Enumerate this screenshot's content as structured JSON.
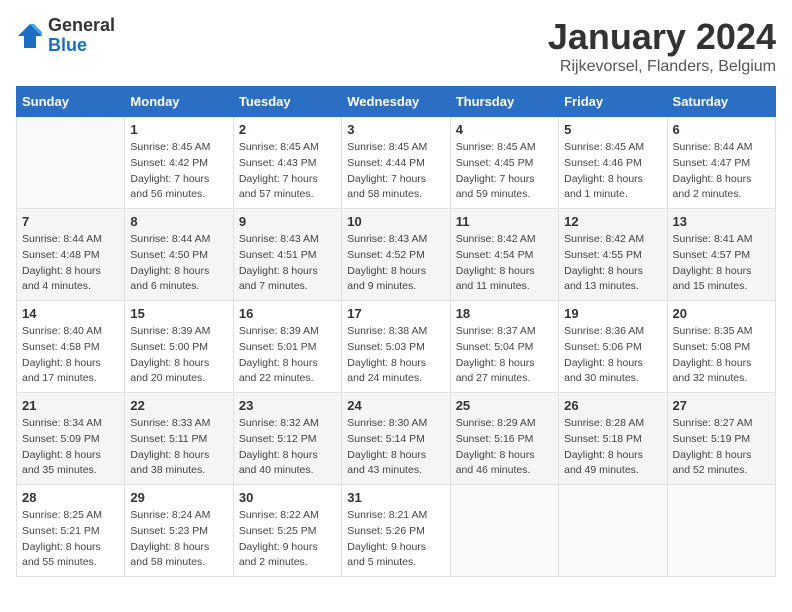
{
  "header": {
    "logo_line1": "General",
    "logo_line2": "Blue",
    "month_title": "January 2024",
    "location": "Rijkevorsel, Flanders, Belgium"
  },
  "weekdays": [
    "Sunday",
    "Monday",
    "Tuesday",
    "Wednesday",
    "Thursday",
    "Friday",
    "Saturday"
  ],
  "weeks": [
    [
      {
        "day": "",
        "info": ""
      },
      {
        "day": "1",
        "info": "Sunrise: 8:45 AM\nSunset: 4:42 PM\nDaylight: 7 hours\nand 56 minutes."
      },
      {
        "day": "2",
        "info": "Sunrise: 8:45 AM\nSunset: 4:43 PM\nDaylight: 7 hours\nand 57 minutes."
      },
      {
        "day": "3",
        "info": "Sunrise: 8:45 AM\nSunset: 4:44 PM\nDaylight: 7 hours\nand 58 minutes."
      },
      {
        "day": "4",
        "info": "Sunrise: 8:45 AM\nSunset: 4:45 PM\nDaylight: 7 hours\nand 59 minutes."
      },
      {
        "day": "5",
        "info": "Sunrise: 8:45 AM\nSunset: 4:46 PM\nDaylight: 8 hours\nand 1 minute."
      },
      {
        "day": "6",
        "info": "Sunrise: 8:44 AM\nSunset: 4:47 PM\nDaylight: 8 hours\nand 2 minutes."
      }
    ],
    [
      {
        "day": "7",
        "info": "Sunrise: 8:44 AM\nSunset: 4:48 PM\nDaylight: 8 hours\nand 4 minutes."
      },
      {
        "day": "8",
        "info": "Sunrise: 8:44 AM\nSunset: 4:50 PM\nDaylight: 8 hours\nand 6 minutes."
      },
      {
        "day": "9",
        "info": "Sunrise: 8:43 AM\nSunset: 4:51 PM\nDaylight: 8 hours\nand 7 minutes."
      },
      {
        "day": "10",
        "info": "Sunrise: 8:43 AM\nSunset: 4:52 PM\nDaylight: 8 hours\nand 9 minutes."
      },
      {
        "day": "11",
        "info": "Sunrise: 8:42 AM\nSunset: 4:54 PM\nDaylight: 8 hours\nand 11 minutes."
      },
      {
        "day": "12",
        "info": "Sunrise: 8:42 AM\nSunset: 4:55 PM\nDaylight: 8 hours\nand 13 minutes."
      },
      {
        "day": "13",
        "info": "Sunrise: 8:41 AM\nSunset: 4:57 PM\nDaylight: 8 hours\nand 15 minutes."
      }
    ],
    [
      {
        "day": "14",
        "info": "Sunrise: 8:40 AM\nSunset: 4:58 PM\nDaylight: 8 hours\nand 17 minutes."
      },
      {
        "day": "15",
        "info": "Sunrise: 8:39 AM\nSunset: 5:00 PM\nDaylight: 8 hours\nand 20 minutes."
      },
      {
        "day": "16",
        "info": "Sunrise: 8:39 AM\nSunset: 5:01 PM\nDaylight: 8 hours\nand 22 minutes."
      },
      {
        "day": "17",
        "info": "Sunrise: 8:38 AM\nSunset: 5:03 PM\nDaylight: 8 hours\nand 24 minutes."
      },
      {
        "day": "18",
        "info": "Sunrise: 8:37 AM\nSunset: 5:04 PM\nDaylight: 8 hours\nand 27 minutes."
      },
      {
        "day": "19",
        "info": "Sunrise: 8:36 AM\nSunset: 5:06 PM\nDaylight: 8 hours\nand 30 minutes."
      },
      {
        "day": "20",
        "info": "Sunrise: 8:35 AM\nSunset: 5:08 PM\nDaylight: 8 hours\nand 32 minutes."
      }
    ],
    [
      {
        "day": "21",
        "info": "Sunrise: 8:34 AM\nSunset: 5:09 PM\nDaylight: 8 hours\nand 35 minutes."
      },
      {
        "day": "22",
        "info": "Sunrise: 8:33 AM\nSunset: 5:11 PM\nDaylight: 8 hours\nand 38 minutes."
      },
      {
        "day": "23",
        "info": "Sunrise: 8:32 AM\nSunset: 5:12 PM\nDaylight: 8 hours\nand 40 minutes."
      },
      {
        "day": "24",
        "info": "Sunrise: 8:30 AM\nSunset: 5:14 PM\nDaylight: 8 hours\nand 43 minutes."
      },
      {
        "day": "25",
        "info": "Sunrise: 8:29 AM\nSunset: 5:16 PM\nDaylight: 8 hours\nand 46 minutes."
      },
      {
        "day": "26",
        "info": "Sunrise: 8:28 AM\nSunset: 5:18 PM\nDaylight: 8 hours\nand 49 minutes."
      },
      {
        "day": "27",
        "info": "Sunrise: 8:27 AM\nSunset: 5:19 PM\nDaylight: 8 hours\nand 52 minutes."
      }
    ],
    [
      {
        "day": "28",
        "info": "Sunrise: 8:25 AM\nSunset: 5:21 PM\nDaylight: 8 hours\nand 55 minutes."
      },
      {
        "day": "29",
        "info": "Sunrise: 8:24 AM\nSunset: 5:23 PM\nDaylight: 8 hours\nand 58 minutes."
      },
      {
        "day": "30",
        "info": "Sunrise: 8:22 AM\nSunset: 5:25 PM\nDaylight: 9 hours\nand 2 minutes."
      },
      {
        "day": "31",
        "info": "Sunrise: 8:21 AM\nSunset: 5:26 PM\nDaylight: 9 hours\nand 5 minutes."
      },
      {
        "day": "",
        "info": ""
      },
      {
        "day": "",
        "info": ""
      },
      {
        "day": "",
        "info": ""
      }
    ]
  ]
}
